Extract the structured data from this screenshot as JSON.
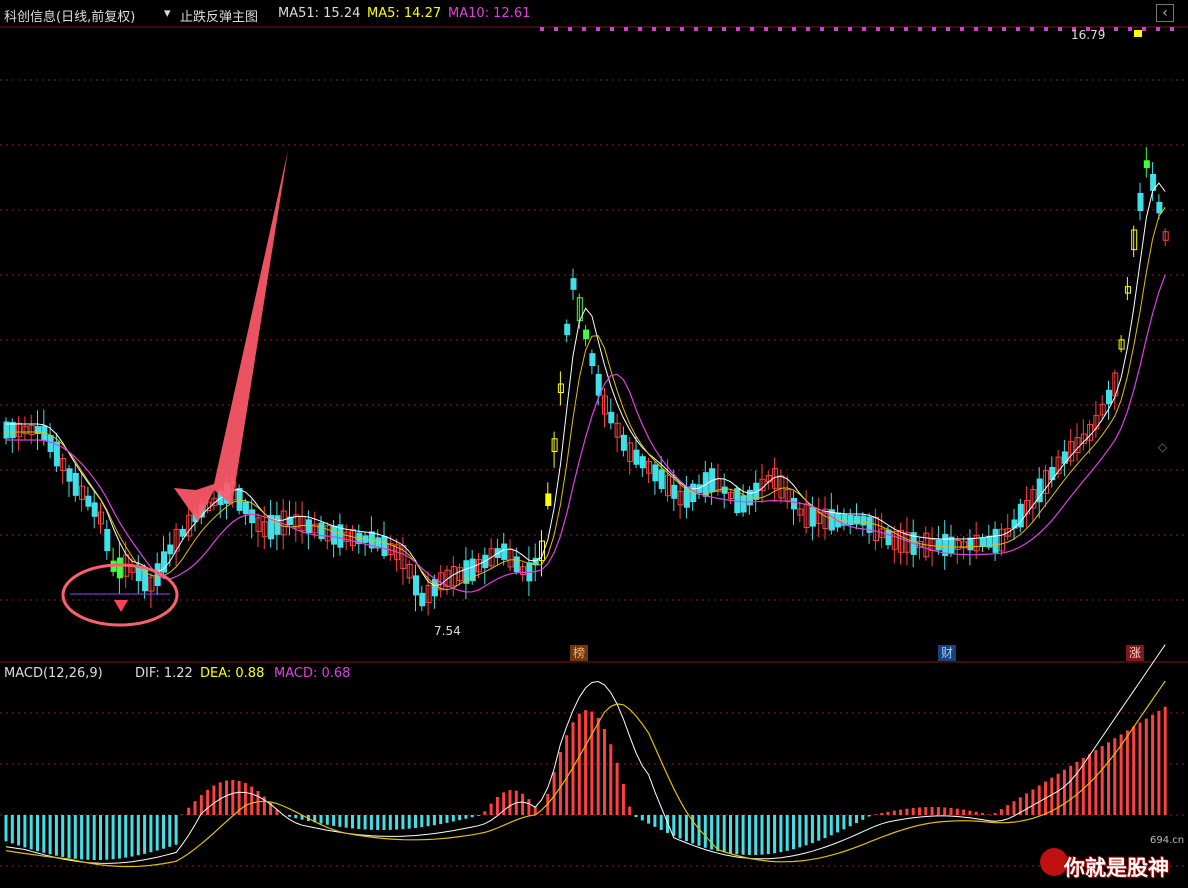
{
  "header": {
    "stock_name": "科创信息(日线,前复权)",
    "indicator": "止跌反弹主图",
    "ma51": "MA51: 15.24",
    "ma5": "MA5: 14.27",
    "ma10": "MA10: 12.61"
  },
  "annotations": {
    "high_label": "16.79",
    "low_label": "7.54",
    "tag_bang": "榜",
    "tag_cai": "财",
    "tag_zhang": "涨"
  },
  "macd_header": {
    "name": "MACD(12,26,9)",
    "dif": "DIF: 1.22",
    "dea": "DEA: 0.88",
    "macd": "MACD: 0.68"
  },
  "watermark": {
    "brand": "你就是股神",
    "site": "694.cn"
  },
  "colors": {
    "up": "#ff4040",
    "down": "#40e0e8",
    "yellow": "#ffff00",
    "green": "#40ff40",
    "ma_white": "#ffffff",
    "ma_yellow": "#e0c000",
    "ma_magenta": "#e040e0",
    "grid": "#8a2020"
  },
  "chart_data": {
    "type": "candlestick",
    "price_high": 16.79,
    "price_low": 7.54,
    "macd": {
      "dif": 1.22,
      "dea": 0.88,
      "macd": 0.68
    }
  }
}
